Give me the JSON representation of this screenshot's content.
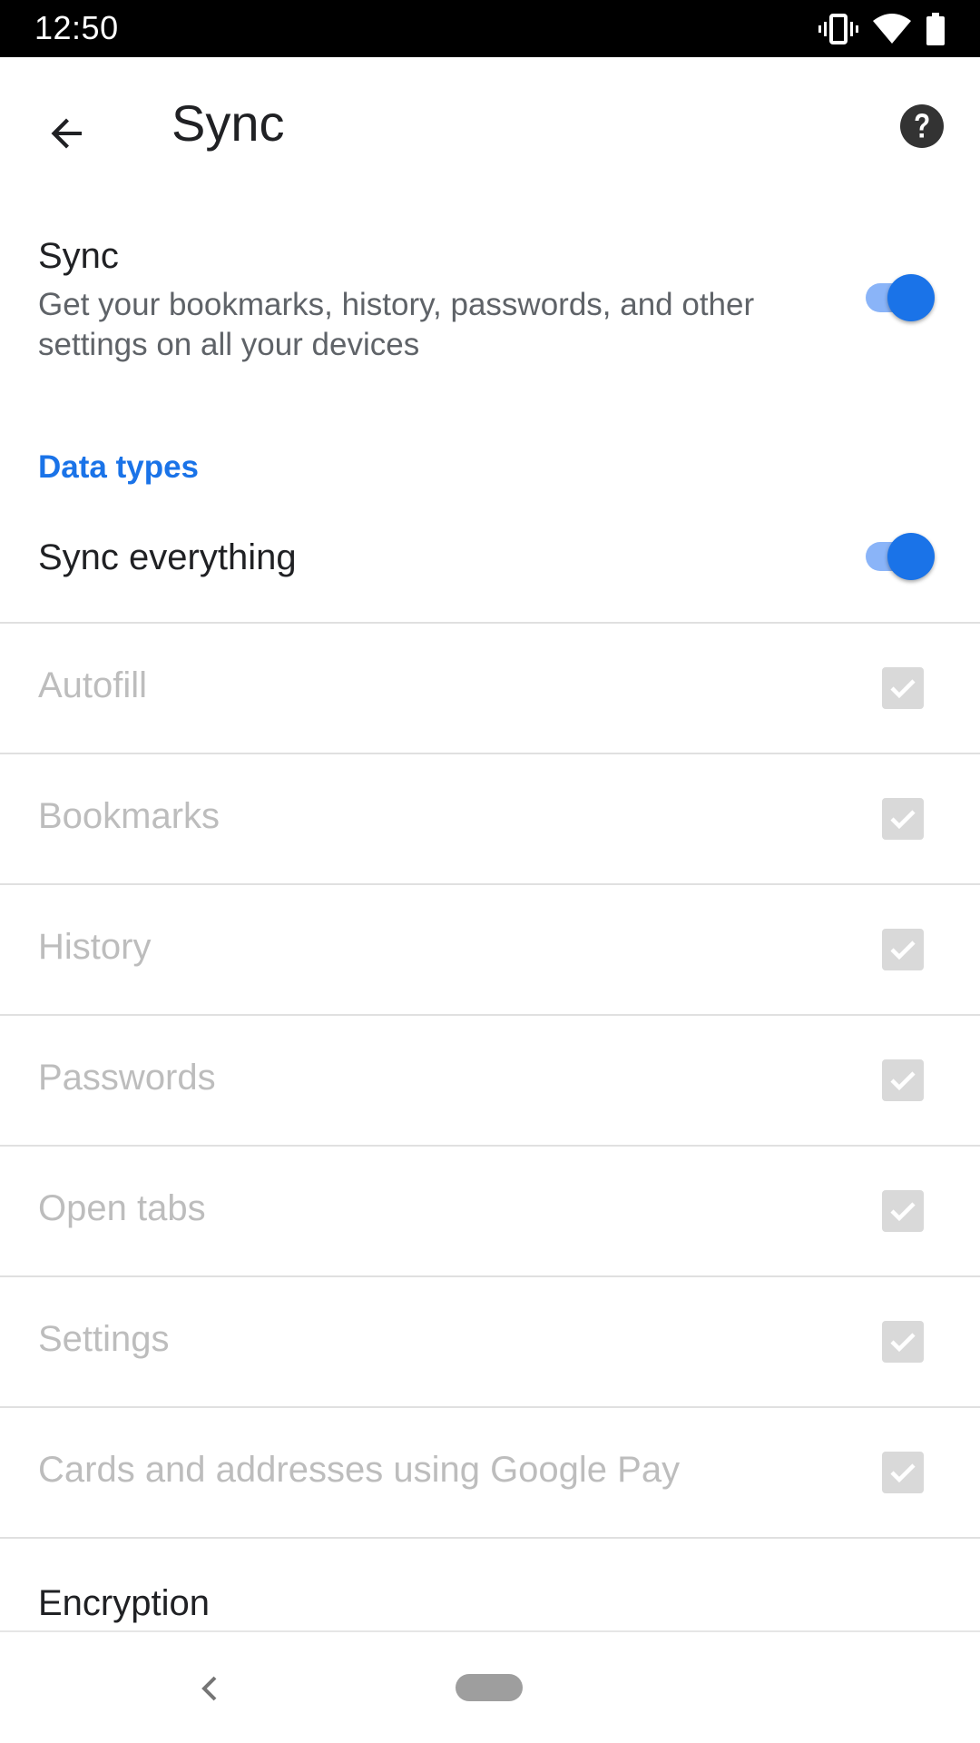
{
  "status_bar": {
    "time": "12:50",
    "icons": [
      "vibrate-icon",
      "wifi-icon",
      "battery-icon"
    ]
  },
  "app_bar": {
    "title": "Sync",
    "back_icon": "arrow-back-icon",
    "help_icon": "help-icon"
  },
  "sync": {
    "title": "Sync",
    "description": "Get your bookmarks, history, passwords, and other settings on all your devices",
    "enabled": true
  },
  "data_types": {
    "header": "Data types",
    "sync_everything_label": "Sync everything",
    "sync_everything_enabled": true,
    "items": [
      {
        "label": "Autofill",
        "checked": true
      },
      {
        "label": "Bookmarks",
        "checked": true
      },
      {
        "label": "History",
        "checked": true
      },
      {
        "label": "Passwords",
        "checked": true
      },
      {
        "label": "Open tabs",
        "checked": true
      },
      {
        "label": "Settings",
        "checked": true
      },
      {
        "label": "Cards and addresses using Google Pay",
        "checked": true
      }
    ]
  },
  "encryption": {
    "label": "Encryption"
  },
  "colors": {
    "accent": "#1a73e8",
    "toggle_track": "#8ab4f8",
    "disabled_text": "#bdbdbd",
    "primary_text": "#202124",
    "secondary_text": "#5f6368"
  }
}
